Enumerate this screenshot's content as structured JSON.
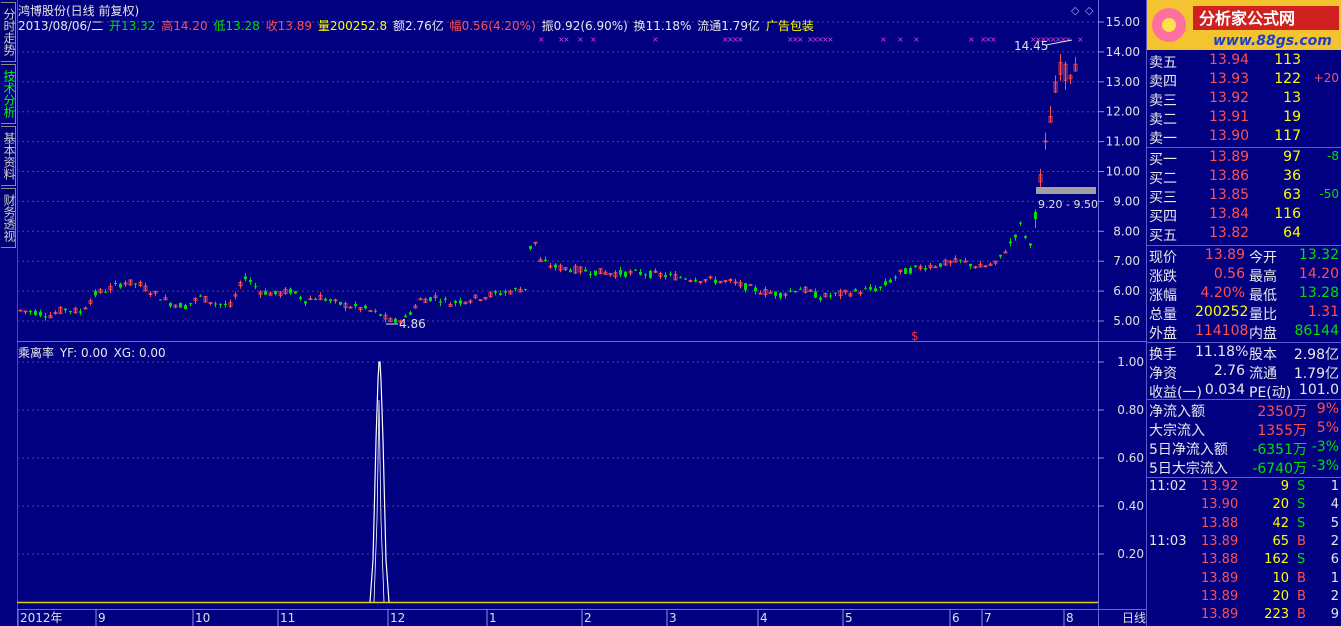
{
  "side_tabs": [
    {
      "label": "分时走势",
      "active": false
    },
    {
      "label": "技术分析",
      "active": true
    },
    {
      "label": "基本资料",
      "active": false
    },
    {
      "label": "财务透视",
      "active": false
    }
  ],
  "header": {
    "title": "鸿博股份(日线 前复权)",
    "date": "2013/08/06/二",
    "open_label": "开",
    "open": "13.32",
    "high_label": "高",
    "high": "14.20",
    "low_label": "低",
    "low": "13.28",
    "close_label": "收",
    "close": "13.89",
    "vol_label": "量",
    "vol": "200252.8",
    "amt_label": "额",
    "amt": "2.76亿",
    "chg_label": "幅",
    "chg": "0.56(4.20%)",
    "amp_label": "振",
    "amp": "0.92(6.90%)",
    "turn_label": "换",
    "turn": "11.18%",
    "float_label": "流通",
    "float": "1.79亿",
    "ad": "广告包装"
  },
  "main_chart": {
    "y_ticks": [
      "15.00",
      "14.00",
      "13.00",
      "12.00",
      "11.00",
      "10.00",
      "9.00",
      "8.00",
      "7.00",
      "6.00",
      "5.00"
    ],
    "annot_high": "14.45",
    "annot_low": "4.86",
    "annot_range": "9.20 - 9.50",
    "marker": "$"
  },
  "sub_chart": {
    "title": "乘离率",
    "yf_label": "YF:",
    "yf": "0.00",
    "xg_label": "XG:",
    "xg": "0.00",
    "y_ticks": [
      "1.00",
      "0.80",
      "0.60",
      "0.40",
      "0.20"
    ]
  },
  "x_axis": {
    "labels": [
      "2012年",
      "9",
      "10",
      "11",
      "12",
      "1",
      "2",
      "3",
      "4",
      "5",
      "6",
      "7",
      "8"
    ],
    "period": "日线"
  },
  "chart_data": {
    "type": "candlestick",
    "series": [
      {
        "name": "鸿博股份"
      }
    ],
    "ylim": [
      4.5,
      15.2
    ],
    "highlight_high": 14.45,
    "highlight_low": 4.86
  },
  "quote": {
    "logo_text": "分析家公式网",
    "logo_url": "www.88gs.com",
    "asks": [
      {
        "label": "卖五",
        "price": "13.94",
        "vol": "113",
        "chg": ""
      },
      {
        "label": "卖四",
        "price": "13.93",
        "vol": "122",
        "chg": "+20"
      },
      {
        "label": "卖三",
        "price": "13.92",
        "vol": "13",
        "chg": ""
      },
      {
        "label": "卖二",
        "price": "13.91",
        "vol": "19",
        "chg": ""
      },
      {
        "label": "卖一",
        "price": "13.90",
        "vol": "117",
        "chg": ""
      }
    ],
    "bids": [
      {
        "label": "买一",
        "price": "13.89",
        "vol": "97",
        "chg": "-8"
      },
      {
        "label": "买二",
        "price": "13.86",
        "vol": "36",
        "chg": ""
      },
      {
        "label": "买三",
        "price": "13.85",
        "vol": "63",
        "chg": "-50"
      },
      {
        "label": "买四",
        "price": "13.84",
        "vol": "116",
        "chg": ""
      },
      {
        "label": "买五",
        "price": "13.82",
        "vol": "64",
        "chg": ""
      }
    ],
    "stats": [
      {
        "l1": "现价",
        "v1": "13.89",
        "l2": "今开",
        "v2": "13.32",
        "c1": "red",
        "c2": "grn"
      },
      {
        "l1": "涨跌",
        "v1": "0.56",
        "l2": "最高",
        "v2": "14.20",
        "c1": "red",
        "c2": "red"
      },
      {
        "l1": "涨幅",
        "v1": "4.20%",
        "l2": "最低",
        "v2": "13.28",
        "c1": "red",
        "c2": "grn"
      },
      {
        "l1": "总量",
        "v1": "200252",
        "l2": "量比",
        "v2": "1.31",
        "c1": "yel",
        "c2": "red"
      },
      {
        "l1": "外盘",
        "v1": "114108",
        "l2": "内盘",
        "v2": "86144",
        "c1": "red",
        "c2": "grn"
      }
    ],
    "stats2": [
      {
        "l1": "换手",
        "v1": "11.18%",
        "l2": "股本",
        "v2": "2.98亿"
      },
      {
        "l1": "净资",
        "v1": "2.76",
        "l2": "流通",
        "v2": "1.79亿"
      },
      {
        "l1": "收益(一)",
        "v1": "0.034",
        "l2": "PE(动)",
        "v2": "101.0"
      }
    ],
    "flows": [
      {
        "label": "净流入额",
        "value": "2350万",
        "pct": "9%",
        "c": "red"
      },
      {
        "label": "大宗流入",
        "value": "1355万",
        "pct": "5%",
        "c": "red"
      },
      {
        "label": "5日净流入额",
        "value": "-6351万",
        "pct": "-3%",
        "c": "grn"
      },
      {
        "label": "5日大宗流入",
        "value": "-6740万",
        "pct": "-3%",
        "c": "grn"
      }
    ],
    "ticks": [
      {
        "time": "11:02",
        "price": "13.92",
        "vol": "9",
        "side": "S",
        "n": "1"
      },
      {
        "time": "",
        "price": "13.90",
        "vol": "20",
        "side": "S",
        "n": "4"
      },
      {
        "time": "",
        "price": "13.88",
        "vol": "42",
        "side": "S",
        "n": "5"
      },
      {
        "time": "11:03",
        "price": "13.89",
        "vol": "65",
        "side": "B",
        "n": "2"
      },
      {
        "time": "",
        "price": "13.88",
        "vol": "162",
        "side": "S",
        "n": "6"
      },
      {
        "time": "",
        "price": "13.89",
        "vol": "10",
        "side": "B",
        "n": "1"
      },
      {
        "time": "",
        "price": "13.89",
        "vol": "20",
        "side": "B",
        "n": "2"
      },
      {
        "time": "",
        "price": "13.89",
        "vol": "223",
        "side": "B",
        "n": "9"
      }
    ]
  }
}
